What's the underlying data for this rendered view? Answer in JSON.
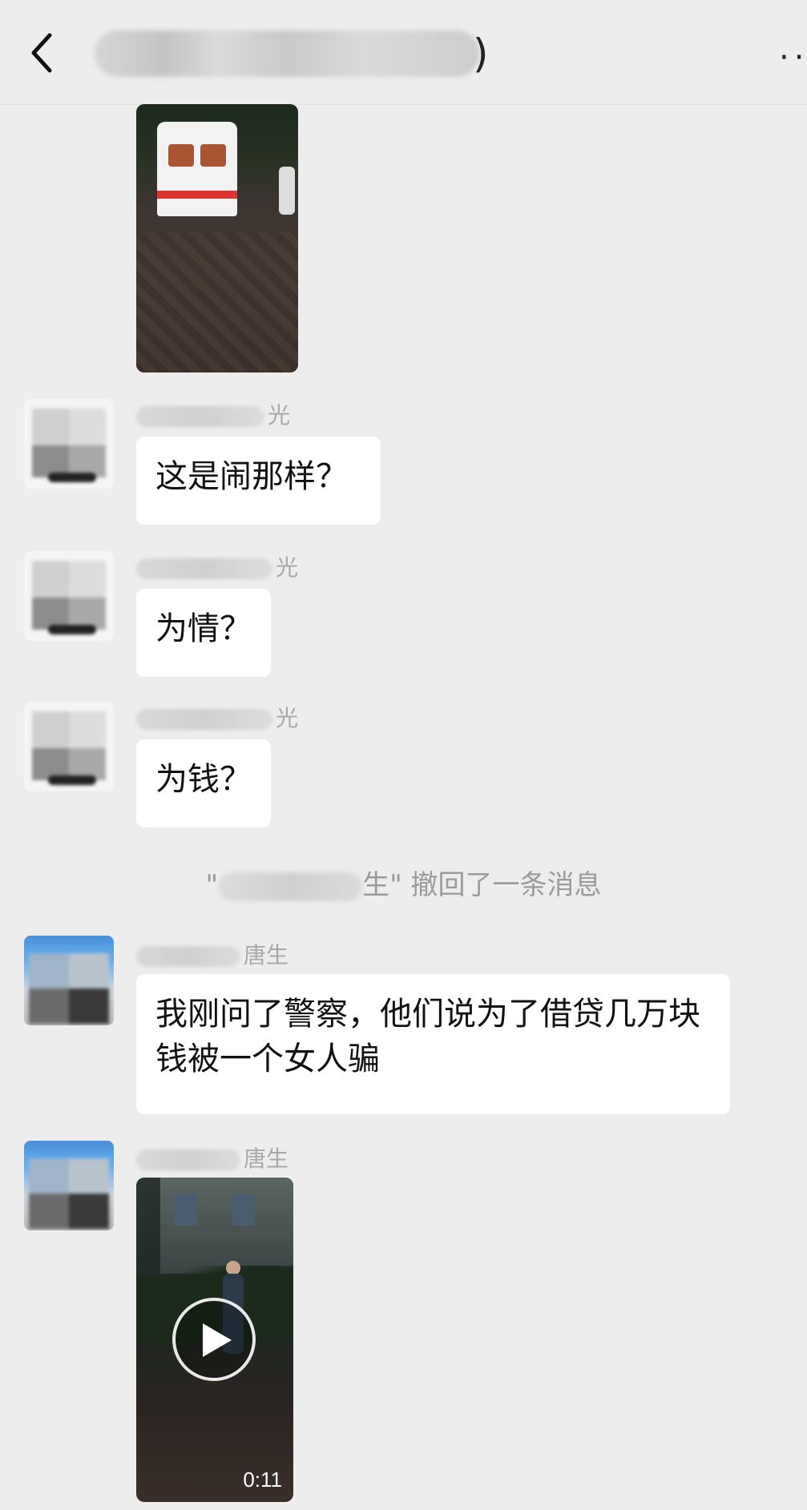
{
  "header": {
    "title_paren": ")",
    "more": "···"
  },
  "messages": [
    {
      "sender_suffix": "光",
      "text": "这是闹那样？"
    },
    {
      "sender_suffix": "光",
      "text": "为情？"
    },
    {
      "sender_suffix": "光",
      "text": "为钱？"
    },
    {
      "sender_suffix": "唐生",
      "text": "我刚问了警察，他们说为了借贷几万块钱被一个女人骗"
    },
    {
      "sender_suffix": "唐生"
    }
  ],
  "system_message": {
    "prefix": "\"",
    "suffix": "生\" 撤回了一条消息"
  },
  "video2": {
    "duration": "0:11"
  },
  "colors": {
    "background": "#ededed",
    "bubble": "#ffffff",
    "meta_text": "#a8a8a8"
  }
}
